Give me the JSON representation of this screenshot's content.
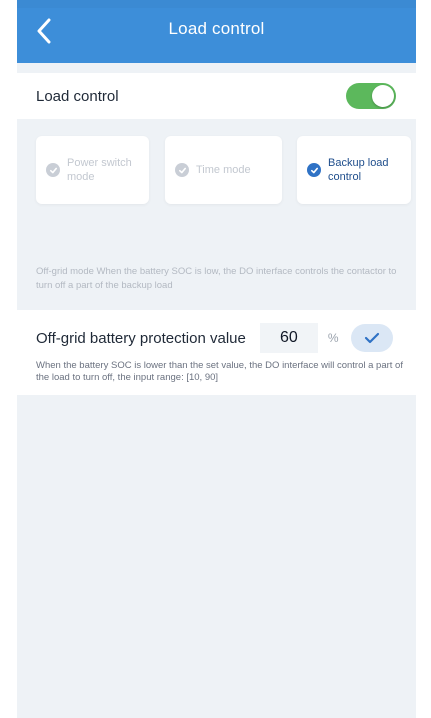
{
  "header": {
    "title": "Load control"
  },
  "load_control": {
    "label": "Load control",
    "enabled": true
  },
  "modes": [
    {
      "label": "Power switch mode",
      "selected": false
    },
    {
      "label": "Time mode",
      "selected": false
    },
    {
      "label": "Backup load control",
      "selected": true
    }
  ],
  "hints": {
    "offgrid_mode": "Off-grid mode When the battery SOC is low, the DO interface controls the contactor to turn off a part of the backup load",
    "protection": "When the battery SOC is lower than the set value, the DO interface will control a part of the load to turn off, the input range: [10, 90]"
  },
  "protection": {
    "label": "Off-grid battery protection value",
    "value": "60",
    "unit": "%"
  },
  "colors": {
    "header": "#3d8ed9",
    "toggle_on": "#5cb85c",
    "selected_radio": "#2f72c5",
    "background": "#eef2f6"
  },
  "icons": {
    "back": "chevron-left-icon",
    "confirm": "check-icon"
  }
}
